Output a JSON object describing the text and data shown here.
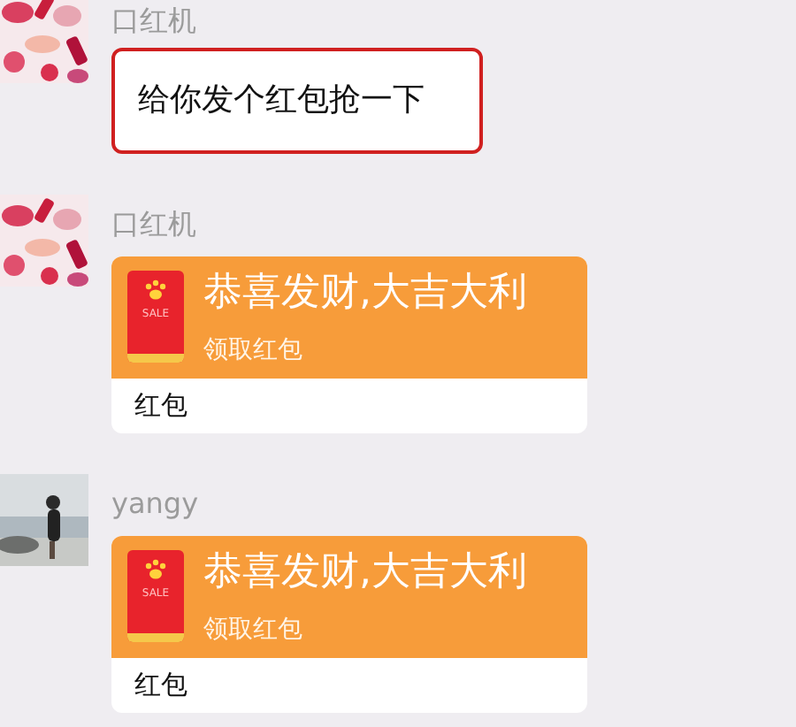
{
  "messages": [
    {
      "kind": "text",
      "sender": "口红机",
      "text": "给你发个红包抢一下",
      "highlighted": true
    },
    {
      "kind": "red_packet",
      "sender": "口红机",
      "title": "恭喜发财,大吉大利",
      "action": "领取红包",
      "icon_label": "SALE",
      "footer": "红包"
    },
    {
      "kind": "red_packet",
      "sender": "yangy",
      "title": "恭喜发财,大吉大利",
      "action": "领取红包",
      "icon_label": "SALE",
      "footer": "红包"
    }
  ]
}
